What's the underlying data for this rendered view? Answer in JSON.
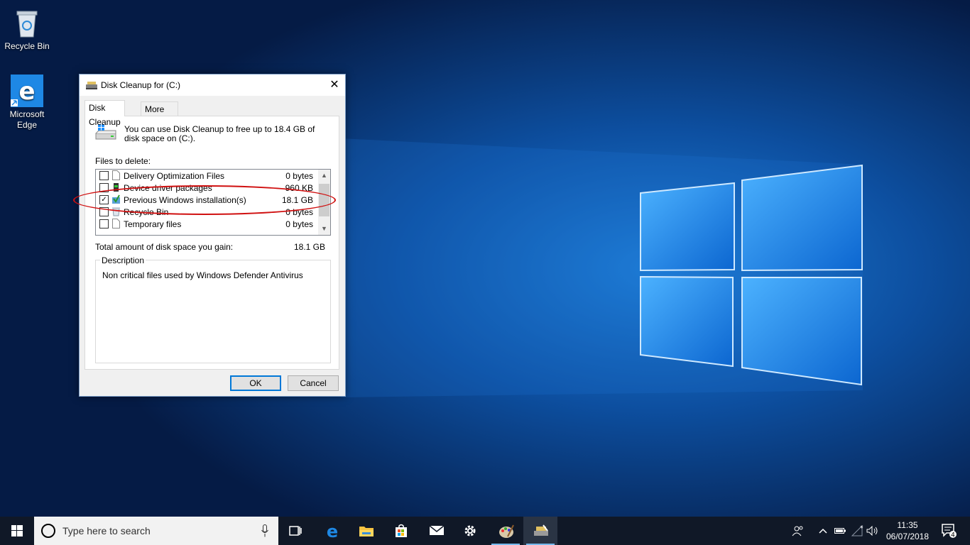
{
  "desktop": {
    "icons": [
      {
        "label": "Recycle Bin"
      },
      {
        "label_line1": "Microsoft",
        "label_line2": "Edge"
      }
    ]
  },
  "dialog": {
    "title": "Disk Cleanup for  (C:)",
    "tabs": [
      "Disk Cleanup",
      "More Options"
    ],
    "intro": "You can use Disk Cleanup to free up to 18.4 GB of disk space on  (C:).",
    "files_label": "Files to delete:",
    "files": [
      {
        "name": "Delivery Optimization Files",
        "size": "0 bytes",
        "checked": false
      },
      {
        "name": "Device driver packages",
        "size": "960 KB",
        "checked": false
      },
      {
        "name": "Previous Windows installation(s)",
        "size": "18.1 GB",
        "checked": true
      },
      {
        "name": "Recycle Bin",
        "size": "0 bytes",
        "checked": false
      },
      {
        "name": "Temporary files",
        "size": "0 bytes",
        "checked": false
      }
    ],
    "total_label": "Total amount of disk space you gain:",
    "total_value": "18.1 GB",
    "description_legend": "Description",
    "description_text": "Non critical files used by Windows Defender Antivirus",
    "ok_label": "OK",
    "cancel_label": "Cancel",
    "close_glyph": "✕"
  },
  "taskbar": {
    "search_placeholder": "Type here to search",
    "clock_time": "11:35",
    "clock_date": "06/07/2018",
    "notification_count": "4",
    "pinned": [
      "task-view-icon",
      "edge-icon",
      "file-explorer-icon",
      "store-icon",
      "mail-icon",
      "settings-icon",
      "paint-icon",
      "disk-cleanup-icon"
    ]
  },
  "colors": {
    "accent": "#0078d7",
    "annotation": "#d01010",
    "taskbar": "#101827"
  }
}
